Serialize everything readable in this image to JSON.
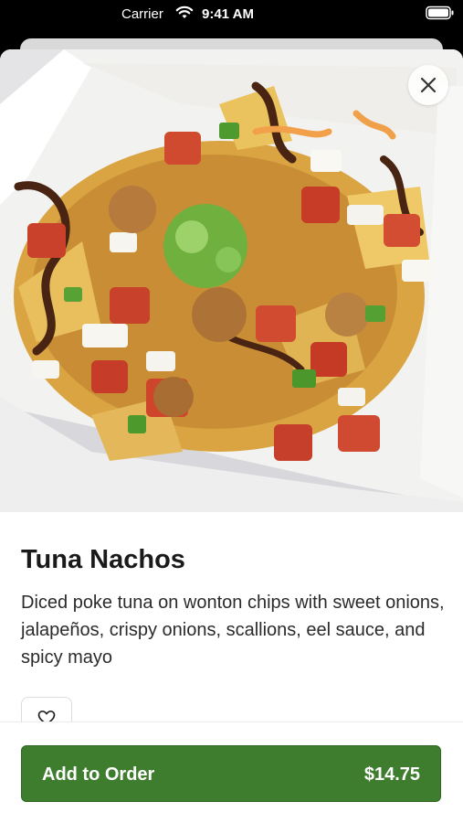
{
  "status_bar": {
    "carrier": "Carrier",
    "time": "9:41 AM",
    "wifi_icon": "wifi-icon",
    "battery_icon": "battery-icon"
  },
  "item": {
    "image_icon": "food-photo",
    "name": "Tuna Nachos",
    "description": "Diced poke tuna on wonton chips with sweet onions, jalapeños, crispy onions, scallions, eel sauce, and spicy mayo"
  },
  "actions": {
    "close_icon": "close-icon",
    "favorite_icon": "heart-icon",
    "add_to_order_label": "Add to Order",
    "price": "$14.75"
  },
  "colors": {
    "accent_green": "#3e7d2e",
    "title_text": "#1a1a1a",
    "background": "#ffffff"
  }
}
